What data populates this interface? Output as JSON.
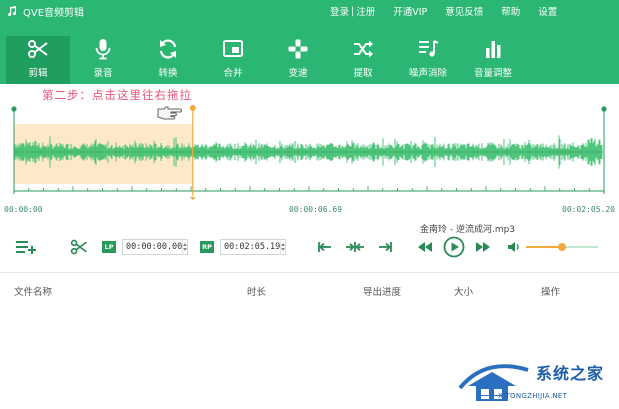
{
  "app": {
    "title": "QVE音频剪辑",
    "logo_icon": "music-note-icon"
  },
  "menu": {
    "login": "登录",
    "separator": "|",
    "register": "注册",
    "vip": "开通VIP",
    "feedback": "意见反馈",
    "help": "帮助",
    "settings": "设置"
  },
  "toolbar": {
    "items": [
      {
        "label": "剪辑",
        "icon": "scissors-icon",
        "active": true
      },
      {
        "label": "录音",
        "icon": "microphone-icon"
      },
      {
        "label": "转换",
        "icon": "convert-icon"
      },
      {
        "label": "合并",
        "icon": "merge-icon"
      },
      {
        "label": "变速",
        "icon": "gamepad-icon"
      },
      {
        "label": "提取",
        "icon": "shuffle-icon"
      },
      {
        "label": "噪声消除",
        "icon": "music-list-icon"
      },
      {
        "label": "音量调整",
        "icon": "volume-bars-icon"
      }
    ]
  },
  "waveform": {
    "hint": "第二步：点击这里往右拖拉",
    "time_start": "00:00:00",
    "time_mid": "00:00:06.69",
    "time_end": "00:02:05.20",
    "selection_fraction": 0.303,
    "selection_color": "#fde8c9",
    "marker_color": "#f2a93b",
    "wave_color": "#3cbf6e"
  },
  "player": {
    "file_name": "金南玲 - 逆流成河.mp3",
    "lp_label": "LP",
    "rp_label": "RP",
    "start_time": "00:00:00.00",
    "end_time": "00:02:05.19",
    "volume_fraction": 0.5
  },
  "file_list": {
    "columns": [
      "文件名称",
      "时长",
      "导出进度",
      "大小",
      "操作"
    ]
  },
  "watermark": {
    "text": "系统之家",
    "url": "XITONGZHIJIA.NET"
  },
  "colors": {
    "brand": "#2bb673",
    "brand_dark": "#1f9e60",
    "accent": "#f2a93b",
    "hint": "#e9557a"
  }
}
